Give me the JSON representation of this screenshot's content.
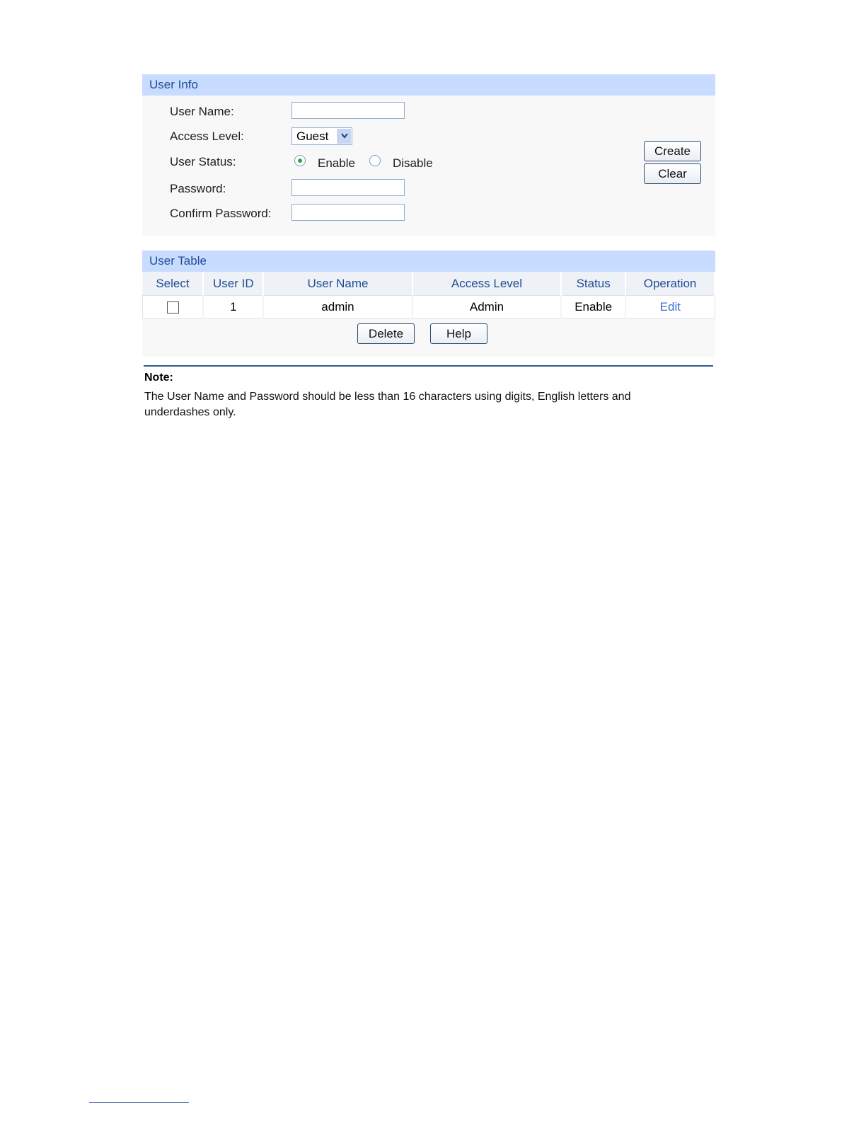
{
  "user_info": {
    "title": "User Info",
    "user_name_label": "User Name:",
    "access_level_label": "Access Level:",
    "access_level_value": "Guest",
    "user_status_label": "User Status:",
    "status_options": [
      "Enable",
      "Disable"
    ],
    "status_selected": "Enable",
    "password_label": "Password:",
    "confirm_password_label": "Confirm Password:",
    "user_name_value": "",
    "password_value": "",
    "confirm_password_value": "",
    "create_button": "Create",
    "clear_button": "Clear"
  },
  "user_table": {
    "title": "User Table",
    "columns": [
      "Select",
      "User ID",
      "User Name",
      "Access Level",
      "Status",
      "Operation"
    ],
    "rows": [
      {
        "user_id": "1",
        "user_name": "admin",
        "access_level": "Admin",
        "status": "Enable",
        "operation": "Edit"
      }
    ],
    "delete_button": "Delete",
    "help_button": "Help"
  },
  "note": {
    "title": "Note:",
    "text": "The User Name and Password should be less than 16 characters using digits, English letters and underdashes only."
  },
  "colors": {
    "header_bg": "#c8dcff",
    "header_text": "#1f4d97",
    "link": "#3a6fcf",
    "radio_selected": "#2da54a",
    "rule": "#2d5d8f"
  }
}
